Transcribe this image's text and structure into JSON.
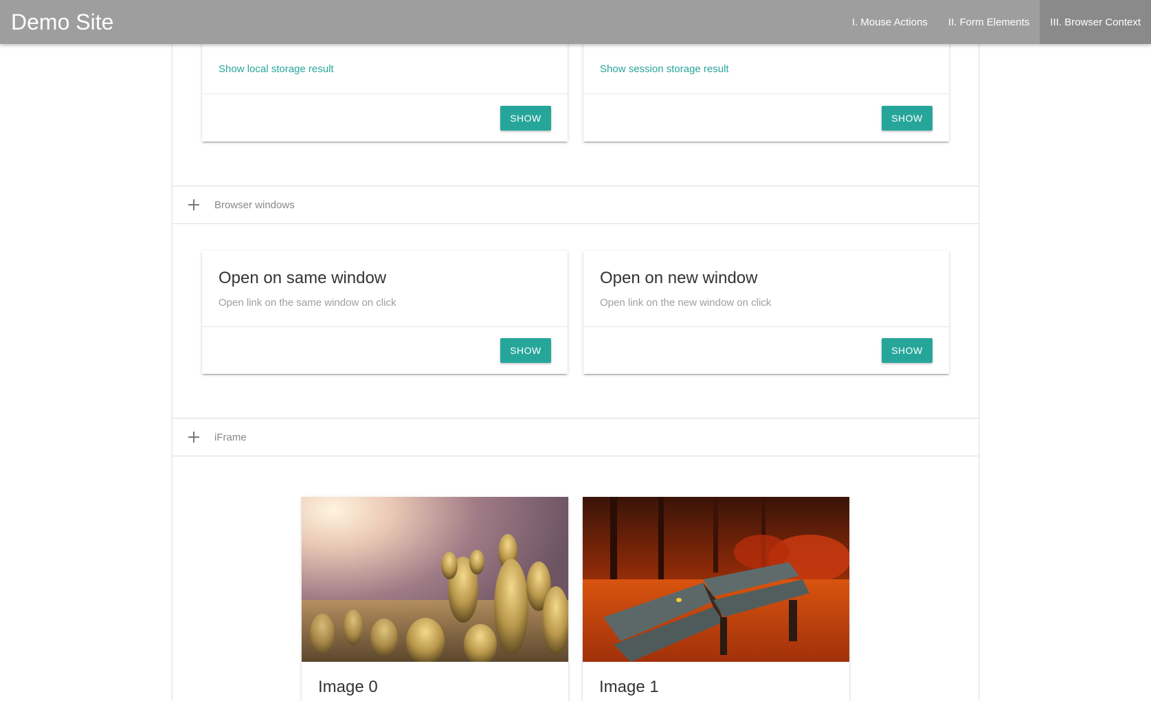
{
  "navbar": {
    "brand": "Demo Site",
    "links": [
      {
        "label": "I. Mouse Actions",
        "active": false
      },
      {
        "label": "II. Form Elements",
        "active": false
      },
      {
        "label": "III. Browser Context",
        "active": true
      }
    ],
    "background": "#9e9e9e"
  },
  "storage": {
    "local": {
      "link": "Show local storage result",
      "button": "SHOW"
    },
    "session": {
      "link": "Show session storage result",
      "button": "SHOW"
    }
  },
  "browser_windows": {
    "header": "Browser windows",
    "icon": "plus-icon",
    "cards": [
      {
        "title": "Open on same window",
        "text": "Open link on the same window on click",
        "button": "SHOW"
      },
      {
        "title": "Open on new window",
        "text": "Open link on the new window on click",
        "button": "SHOW"
      }
    ]
  },
  "iframe": {
    "header": "iFrame",
    "icon": "plus-icon",
    "images": [
      {
        "title": "Image 0",
        "description": "cactus plants in warm sunlight"
      },
      {
        "title": "Image 1",
        "description": "wooden benches in red autumn park"
      }
    ]
  },
  "colors": {
    "accent": "#26a69a",
    "muted_text": "#9e9e9e"
  }
}
